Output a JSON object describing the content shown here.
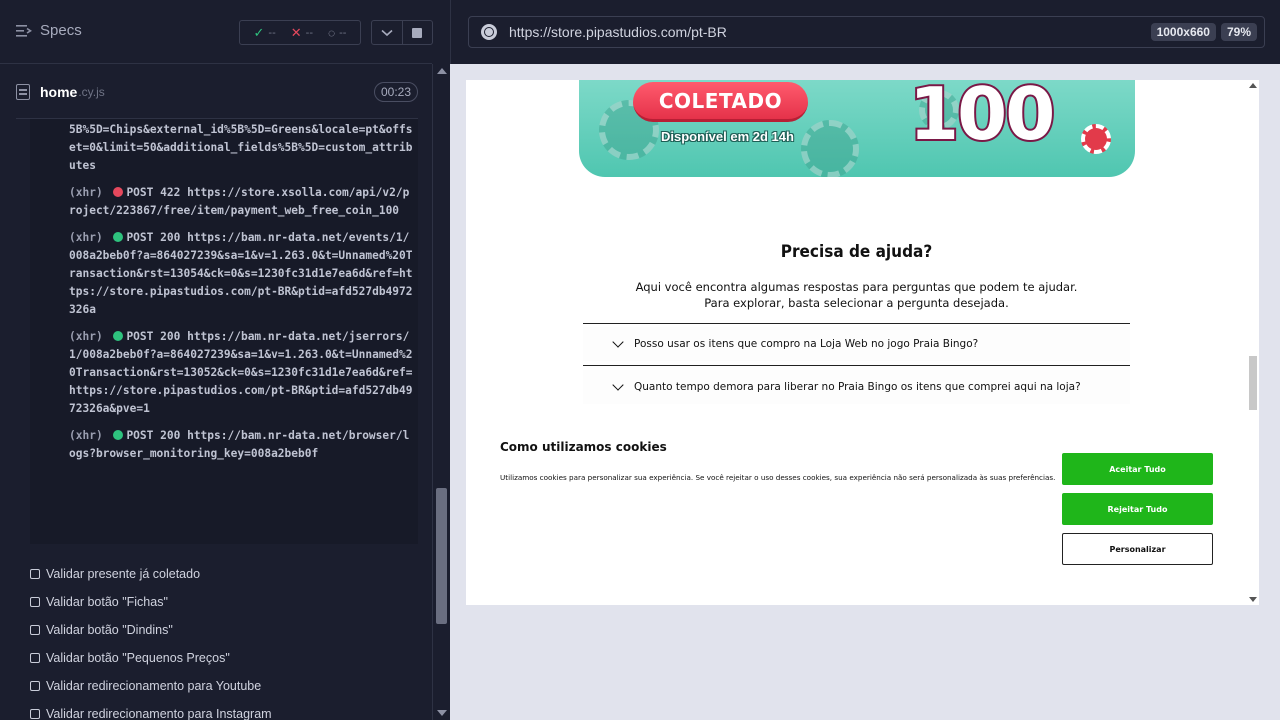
{
  "runner": {
    "specs_label": "Specs",
    "stats": {
      "passed": "--",
      "failed": "--",
      "pending": "--"
    },
    "file": {
      "name": "home",
      "ext": ".cy.js",
      "timer": "00:23"
    },
    "log": [
      {
        "tag": "",
        "status": "",
        "dot": "",
        "text": "5B%5D=Chips&external_id%5B%5D=Greens&locale=pt&offset=0&limit=50&additional_fields%5B%5D=custom_attributes"
      },
      {
        "tag": "(xhr)",
        "status": "POST 422",
        "dot": "red",
        "text": "https://store.xsolla.com/api/v2/project/223867/free/item/payment_web_free_coin_100"
      },
      {
        "tag": "(xhr)",
        "status": "POST 200",
        "dot": "green",
        "text": "https://bam.nr-data.net/events/1/008a2beb0f?a=864027239&sa=1&v=1.263.0&t=Unnamed%20Transaction&rst=13054&ck=0&s=1230fc31d1e7ea6d&ref=https://store.pipastudios.com/pt-BR&ptid=afd527db4972326a"
      },
      {
        "tag": "(xhr)",
        "status": "POST 200",
        "dot": "green",
        "text": "https://bam.nr-data.net/jserrors/1/008a2beb0f?a=864027239&sa=1&v=1.263.0&t=Unnamed%20Transaction&rst=13052&ck=0&s=1230fc31d1e7ea6d&ref=https://store.pipastudios.com/pt-BR&ptid=afd527db4972326a&pve=1"
      },
      {
        "tag": "(xhr)",
        "status": "POST 200",
        "dot": "green",
        "text": "https://bam.nr-data.net/browser/logs?browser_monitoring_key=008a2beb0f"
      }
    ],
    "tests": [
      "Validar presente já coletado",
      "Validar botão \"Fichas\"",
      "Validar botão \"Dindins\"",
      "Validar botão \"Pequenos Preços\"",
      "Validar redirecionamento para Youtube",
      "Validar redirecionamento para Instagram"
    ]
  },
  "browser": {
    "url": "https://store.pipastudios.com/pt-BR",
    "viewport": "1000x660",
    "zoom": "79%"
  },
  "page": {
    "banner": {
      "button": "COLETADO",
      "available": "Disponível em 2d 14h",
      "amount": "100"
    },
    "help": {
      "title": "Precisa de ajuda?",
      "subtitle_line1": "Aqui você encontra algumas respostas para perguntas que podem te ajudar.",
      "subtitle_line2": "Para explorar, basta selecionar a pergunta desejada.",
      "faq": [
        "Posso usar os itens que compro na Loja Web no jogo Praia Bingo?",
        "Quanto tempo demora para liberar no Praia Bingo os itens que comprei aqui na loja?"
      ]
    },
    "cookies": {
      "title": "Como utilizamos cookies",
      "text": "Utilizamos cookies para personalizar sua experiência. Se você rejeitar o uso desses cookies, sua experiência não será personalizada às suas preferências.",
      "accept": "Aceitar Tudo",
      "reject": "Rejeitar Tudo",
      "customize": "Personalizar"
    }
  },
  "colors": {
    "runner_bg": "#1b1e2e",
    "pass": "#2ec27e",
    "fail": "#e5485d",
    "cookie_green": "#1fb61a",
    "banner_teal": "#4fc6b0",
    "collected_red": "#e5324a"
  }
}
